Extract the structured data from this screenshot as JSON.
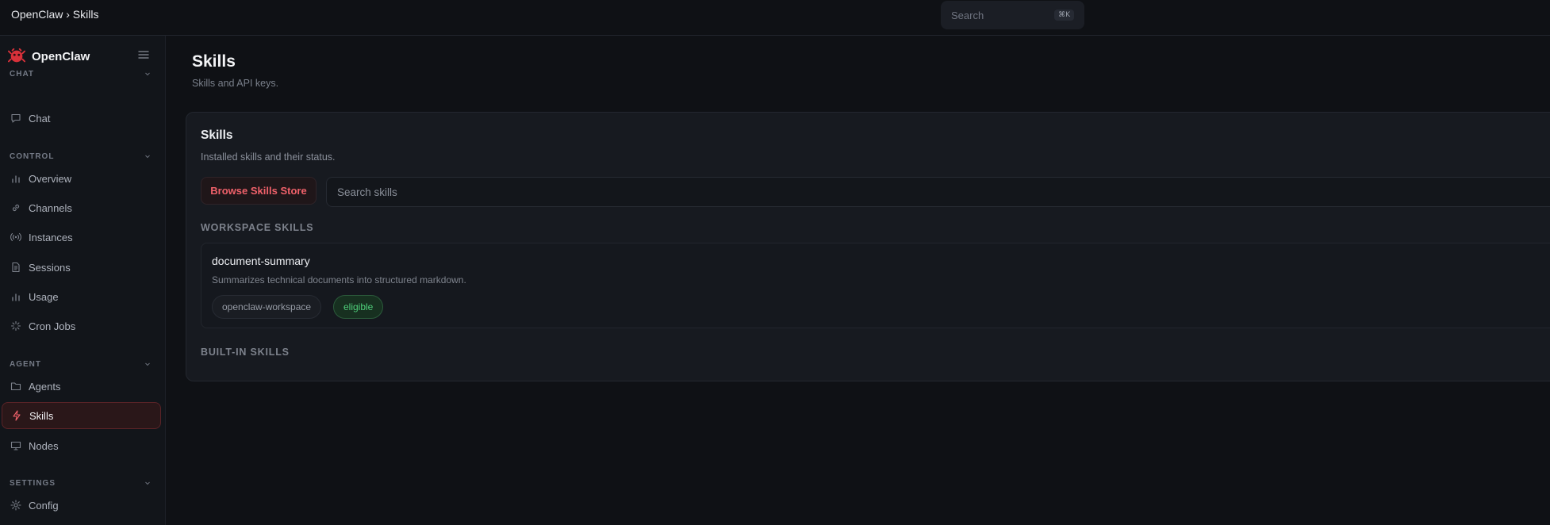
{
  "header": {
    "breadcrumb": "OpenClaw › Skills",
    "search_placeholder": "Search",
    "search_shortcut": "⌘K"
  },
  "sidebar": {
    "brand": "OpenClaw",
    "sections": [
      {
        "label": "CHAT",
        "items": [
          {
            "label": "Chat",
            "icon": "chat-bubble-icon"
          }
        ]
      },
      {
        "label": "CONTROL",
        "items": [
          {
            "label": "Overview",
            "icon": "bar-chart-icon"
          },
          {
            "label": "Channels",
            "icon": "link-icon"
          },
          {
            "label": "Instances",
            "icon": "radio-signal-icon"
          },
          {
            "label": "Sessions",
            "icon": "document-icon"
          },
          {
            "label": "Usage",
            "icon": "bar-chart-icon"
          },
          {
            "label": "Cron Jobs",
            "icon": "loader-icon"
          }
        ]
      },
      {
        "label": "AGENT",
        "items": [
          {
            "label": "Agents",
            "icon": "folder-icon"
          },
          {
            "label": "Skills",
            "icon": "lightning-icon",
            "active": true
          },
          {
            "label": "Nodes",
            "icon": "monitor-icon"
          }
        ]
      },
      {
        "label": "SETTINGS",
        "items": [
          {
            "label": "Config",
            "icon": "gear-icon"
          }
        ]
      }
    ]
  },
  "main": {
    "title": "Skills",
    "subtitle": "Skills and API keys.",
    "card": {
      "title": "Skills",
      "description": "Installed skills and their status.",
      "browse_button": "Browse Skills Store",
      "search_placeholder": "Search skills",
      "workspace_label": "WORKSPACE SKILLS",
      "builtin_label": "BUILT-IN SKILLS",
      "skills": [
        {
          "name": "document-summary",
          "description": "Summarizes technical documents into structured markdown.",
          "source": "openclaw-workspace",
          "status": "eligible"
        }
      ]
    }
  },
  "colors": {
    "accent": "#f0616a",
    "eligible": "#4fcf7a",
    "background": "#0f1115"
  }
}
